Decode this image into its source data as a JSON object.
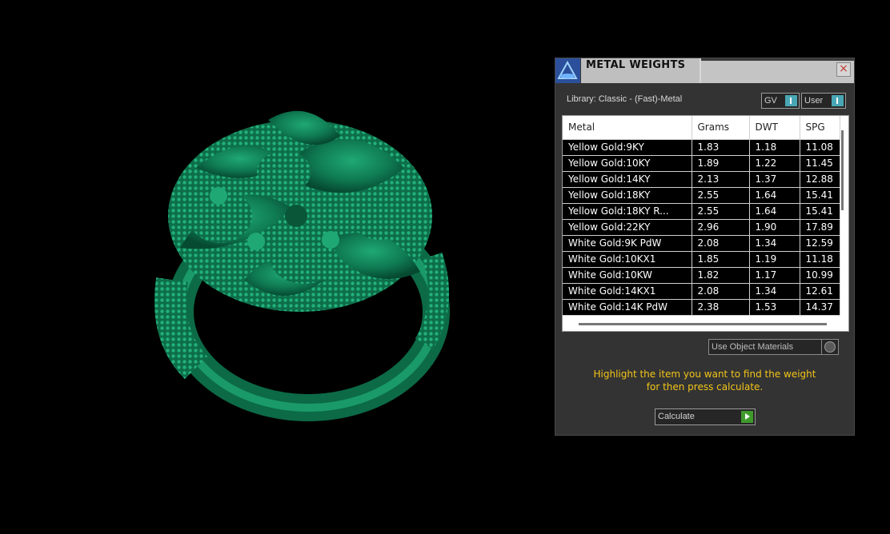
{
  "panel": {
    "title": "METAL WEIGHTS",
    "close_label": "×",
    "library": "Library: Classic - (Fast)-Metal",
    "toggles": [
      {
        "label": "GV"
      },
      {
        "label": "User"
      }
    ],
    "columns": [
      "Metal",
      "Grams",
      "DWT",
      "SPG"
    ],
    "rows": [
      [
        "Yellow Gold:9KY",
        "1.83",
        "1.18",
        "11.08"
      ],
      [
        "Yellow Gold:10KY",
        "1.89",
        "1.22",
        "11.45"
      ],
      [
        "Yellow Gold:14KY",
        "2.13",
        "1.37",
        "12.88"
      ],
      [
        "Yellow Gold:18KY",
        "2.55",
        "1.64",
        "15.41"
      ],
      [
        "Yellow Gold:18KY R...",
        "2.55",
        "1.64",
        "15.41"
      ],
      [
        "Yellow Gold:22KY",
        "2.96",
        "1.90",
        "17.89"
      ],
      [
        "White Gold:9K PdW",
        "2.08",
        "1.34",
        "12.59"
      ],
      [
        "White Gold:10KX1",
        "1.85",
        "1.19",
        "11.18"
      ],
      [
        "White Gold:10KW",
        "1.82",
        "1.17",
        "10.99"
      ],
      [
        "White Gold:14KX1",
        "2.08",
        "1.34",
        "12.61"
      ],
      [
        "White Gold:14K PdW",
        "2.38",
        "1.53",
        "14.37"
      ]
    ],
    "use_object_materials": "Use Object Materials",
    "hint_line1": "Highlight the item you want to find the weight",
    "hint_line2": "for then press calculate.",
    "calculate_label": "Calculate"
  },
  "colors": {
    "ring": "#0f7a52",
    "hint": "#f2c418",
    "toggle_knob": "#49a6b4",
    "calculate_go": "#3f9a2c"
  }
}
